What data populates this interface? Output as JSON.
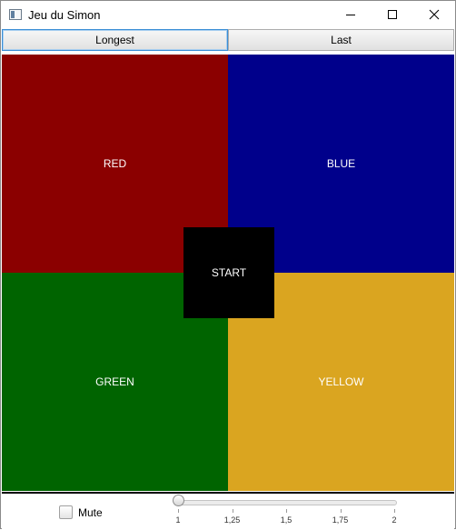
{
  "window": {
    "title": "Jeu du Simon"
  },
  "window_controls": {
    "minimize_icon": "minimize-icon",
    "maximize_icon": "maximize-icon",
    "close_icon": "close-icon"
  },
  "toolbar": {
    "longest_label": "Longest",
    "last_label": "Last"
  },
  "board": {
    "quadrants": [
      {
        "label": "RED",
        "color": "#8b0000"
      },
      {
        "label": "BLUE",
        "color": "#00008b"
      },
      {
        "label": "GREEN",
        "color": "#006400"
      },
      {
        "label": "YELLOW",
        "color": "#daa520"
      }
    ],
    "start_label": "START"
  },
  "footer": {
    "mute_label": "Mute",
    "mute_checked": false,
    "speed_slider": {
      "min": 1,
      "max": 2,
      "value": 1,
      "tick_labels": [
        "1",
        "1,25",
        "1,5",
        "1,75",
        "2"
      ]
    }
  }
}
